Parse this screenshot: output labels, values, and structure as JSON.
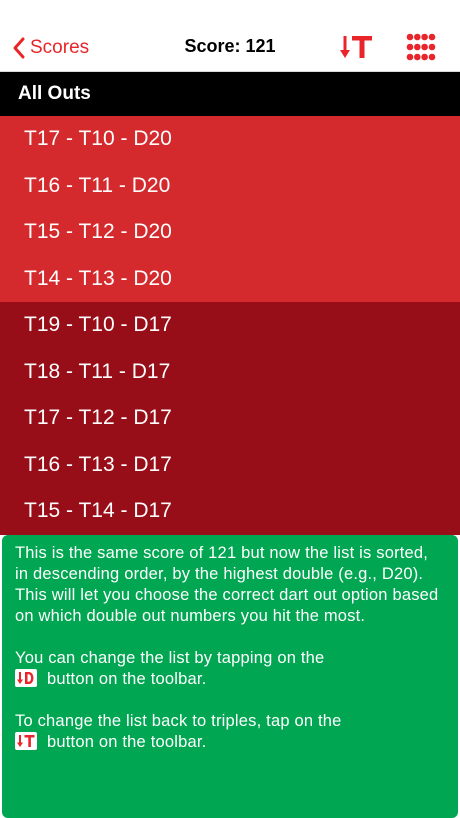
{
  "navbar": {
    "back_label": "Scores",
    "title": "Score: 121",
    "accent_color": "#e8252b",
    "sort_icon": "sort-triples-icon",
    "grid_icon": "grid-icon"
  },
  "section": {
    "header": "All Outs"
  },
  "groups": [
    {
      "color": "#d42a2d",
      "rows": [
        "T17 - T10 - D20",
        "T16 - T11 - D20",
        "T15 - T12 - D20",
        "T14 - T13 - D20"
      ]
    },
    {
      "color": "#970e18",
      "rows": [
        "T19 - T10 - D17",
        "T18 - T11 - D17",
        "T17 - T12 - D17",
        "T16 - T13 - D17",
        "T15 - T14 - D17"
      ]
    }
  ],
  "info": {
    "background": "#00a651",
    "paragraph1": "This is the same score of 121 but now the list is sorted, in descending order, by the highest double (e.g., D20).  This will let you choose the correct dart out option based on which double out numbers you hit the most.",
    "paragraph2_line1": "You can change the list by tapping on the",
    "paragraph2_line2": "button on the toolbar.",
    "paragraph3_line1": "To change the list back to triples, tap on the",
    "paragraph3_line2": "button on the toolbar."
  }
}
